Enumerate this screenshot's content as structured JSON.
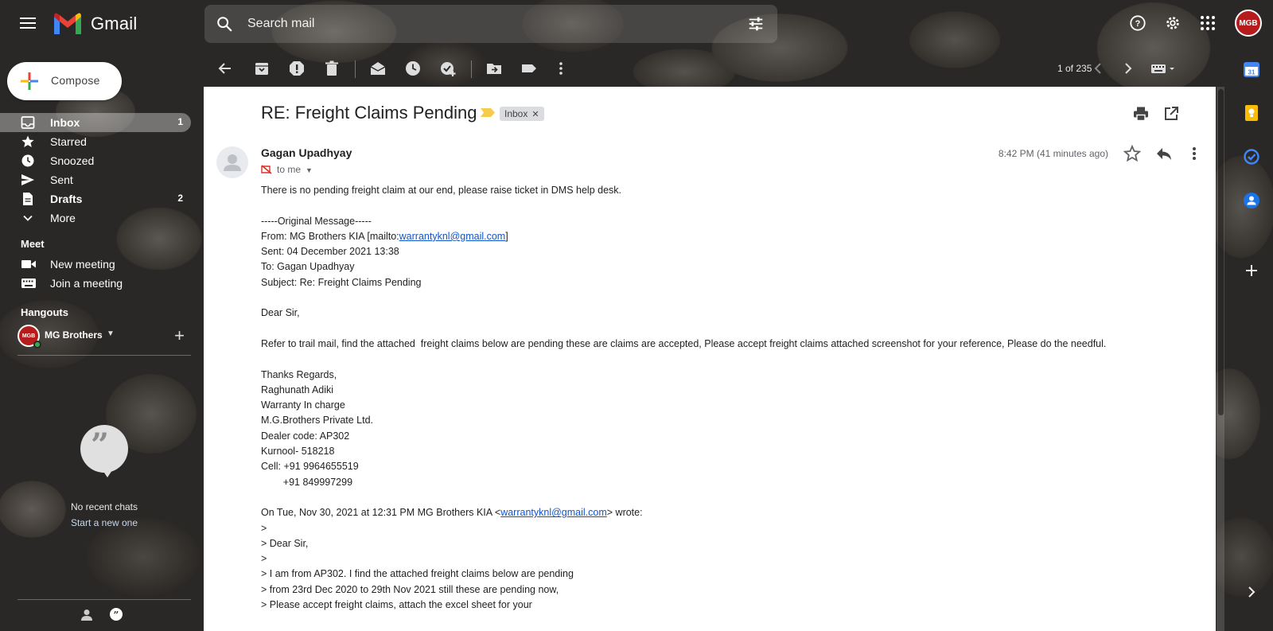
{
  "app": {
    "name": "Gmail"
  },
  "search": {
    "placeholder": "Search mail"
  },
  "account": {
    "avatar_text": "MGB"
  },
  "compose": {
    "label": "Compose"
  },
  "nav": [
    {
      "label": "Inbox",
      "count": "1"
    },
    {
      "label": "Starred",
      "count": ""
    },
    {
      "label": "Snoozed",
      "count": ""
    },
    {
      "label": "Sent",
      "count": ""
    },
    {
      "label": "Drafts",
      "count": "2"
    },
    {
      "label": "More",
      "count": ""
    }
  ],
  "meet": {
    "title": "Meet",
    "new_meeting": "New meeting",
    "join_meeting": "Join a meeting"
  },
  "hangouts": {
    "title": "Hangouts",
    "user": "MG Brothers",
    "avatar_text": "MGB",
    "no_recent": "No recent chats",
    "start_new": "Start a new one"
  },
  "toolbar": {
    "pager": "1 of 235"
  },
  "email": {
    "subject": "RE: Freight Claims Pending",
    "label_chip": "Inbox",
    "sender": "Gagan Upadhyay",
    "to": "to me",
    "date": "8:42 PM (41 minutes ago)",
    "link_email": "warrantyknl@gmail.com",
    "body": [
      "There is no pending freight claim at our end, please raise ticket in DMS help desk.",
      "",
      "-----Original Message-----",
      "",
      "Sent: 04 December 2021 13:38",
      "To: Gagan Upadhyay",
      "Subject: Re: Freight Claims Pending",
      "",
      "Dear Sir,",
      "",
      "Refer to trail mail, find the attached  freight claims below are pending these are claims are accepted, Please accept freight claims attached screenshot for your reference, Please do the needful.",
      "",
      "Thanks Regards,",
      "Raghunath Adiki",
      "Warranty In charge",
      "M.G.Brothers Private Ltd.",
      "Dealer code: AP302",
      "Kurnool- 518218",
      "Cell: +91 9964655519",
      "        +91 849997299",
      "",
      "",
      ">",
      "> Dear Sir,",
      ">",
      "> I am from AP302. I find the attached freight claims below are pending",
      "> from 23rd Dec 2020 to 29th Nov 2021 still these are pending now,",
      "> Please accept freight claims, attach the excel sheet for your"
    ],
    "from_line": {
      "before": "From: MG Brothers KIA [mailto:",
      "after": "]"
    },
    "wrote_line": {
      "before": "On Tue, Nov 30, 2021 at 12:31 PM MG Brothers KIA <",
      "after": "> wrote:"
    }
  },
  "colors": {
    "gmail_red": "#ea4335",
    "gmail_blue": "#4285f4",
    "gmail_yellow": "#fbbc04",
    "gmail_green": "#34a853",
    "link": "#1155cc",
    "important_marker": "#f7cb4d"
  }
}
